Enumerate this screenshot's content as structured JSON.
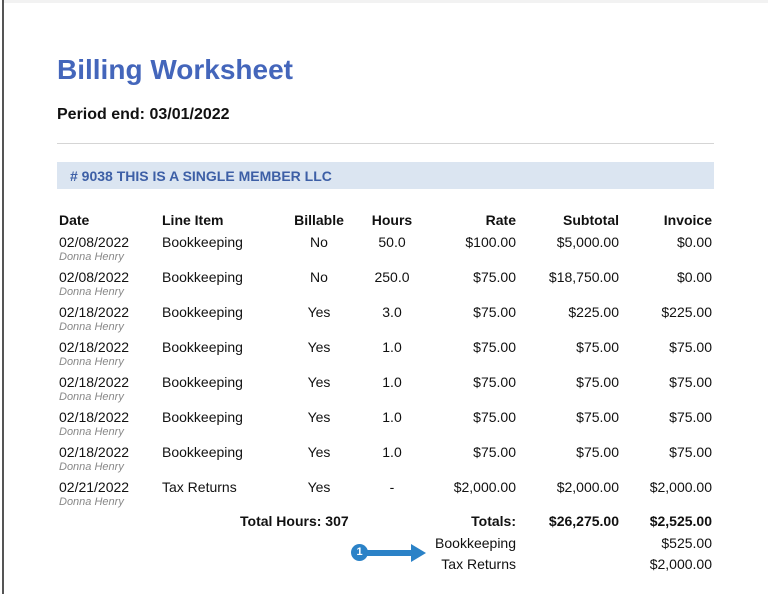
{
  "title": "Billing Worksheet",
  "period": "Period end: 03/01/2022",
  "client": "# 9038 THIS IS A SINGLE MEMBER LLC",
  "columns": {
    "date": "Date",
    "line_item": "Line Item",
    "billable": "Billable",
    "hours": "Hours",
    "rate": "Rate",
    "subtotal": "Subtotal",
    "invoice": "Invoice"
  },
  "rows": [
    {
      "date": "02/08/2022",
      "staff": "Donna Henry",
      "item": "Bookkeeping",
      "billable": "No",
      "hours": "50.0",
      "rate": "$100.00",
      "subtotal": "$5,000.00",
      "invoice": "$0.00"
    },
    {
      "date": "02/08/2022",
      "staff": "Donna Henry",
      "item": "Bookkeeping",
      "billable": "No",
      "hours": "250.0",
      "rate": "$75.00",
      "subtotal": "$18,750.00",
      "invoice": "$0.00"
    },
    {
      "date": "02/18/2022",
      "staff": "Donna Henry",
      "item": "Bookkeeping",
      "billable": "Yes",
      "hours": "3.0",
      "rate": "$75.00",
      "subtotal": "$225.00",
      "invoice": "$225.00"
    },
    {
      "date": "02/18/2022",
      "staff": "Donna Henry",
      "item": "Bookkeeping",
      "billable": "Yes",
      "hours": "1.0",
      "rate": "$75.00",
      "subtotal": "$75.00",
      "invoice": "$75.00"
    },
    {
      "date": "02/18/2022",
      "staff": "Donna Henry",
      "item": "Bookkeeping",
      "billable": "Yes",
      "hours": "1.0",
      "rate": "$75.00",
      "subtotal": "$75.00",
      "invoice": "$75.00"
    },
    {
      "date": "02/18/2022",
      "staff": "Donna Henry",
      "item": "Bookkeeping",
      "billable": "Yes",
      "hours": "1.0",
      "rate": "$75.00",
      "subtotal": "$75.00",
      "invoice": "$75.00"
    },
    {
      "date": "02/18/2022",
      "staff": "Donna Henry",
      "item": "Bookkeeping",
      "billable": "Yes",
      "hours": "1.0",
      "rate": "$75.00",
      "subtotal": "$75.00",
      "invoice": "$75.00"
    },
    {
      "date": "02/21/2022",
      "staff": "Donna Henry",
      "item": "Tax Returns",
      "billable": "Yes",
      "hours": "-",
      "rate": "$2,000.00",
      "subtotal": "$2,000.00",
      "invoice": "$2,000.00"
    }
  ],
  "totals": {
    "hours_label": "Total Hours: 307",
    "label": "Totals:",
    "subtotal": "$26,275.00",
    "invoice": "$2,525.00"
  },
  "breakdown": [
    {
      "label": "Bookkeeping",
      "amount": "$525.00"
    },
    {
      "label": "Tax Returns",
      "amount": "$2,000.00"
    }
  ],
  "callout": {
    "number": "1",
    "color": "#2b82c7"
  },
  "colors": {
    "title": "#4466bb",
    "client_band": "#dbe5f1",
    "client_text": "#3d5fa6"
  }
}
